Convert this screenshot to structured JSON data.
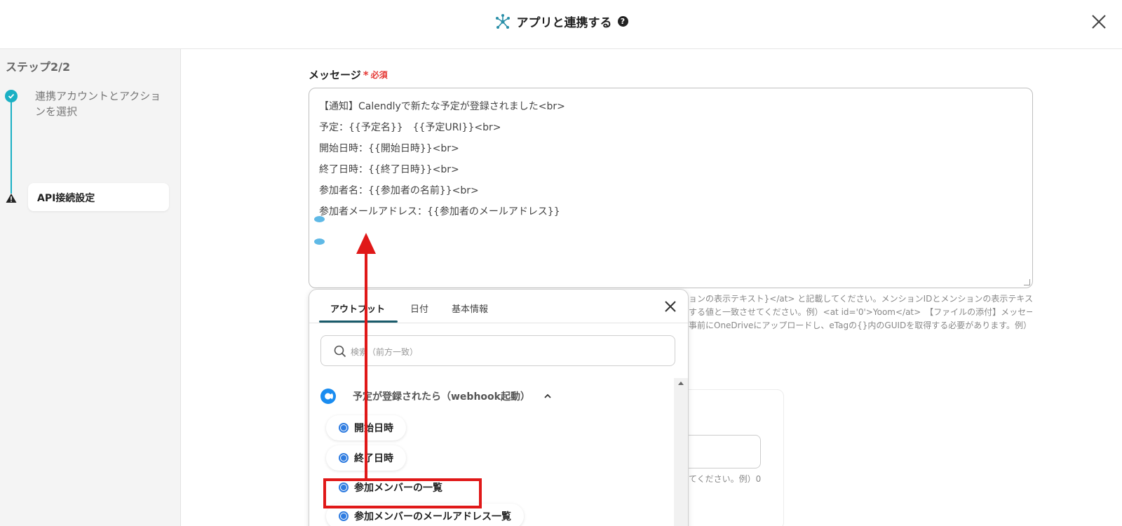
{
  "header": {
    "title": "アプリと連携する",
    "help_glyph": "?"
  },
  "sidebar": {
    "step_title": "ステップ2/2",
    "steps": [
      {
        "label": "連携アカウントとアクションを選択",
        "status": "done"
      },
      {
        "label": "API接続設定",
        "status": "warning"
      }
    ]
  },
  "message_field": {
    "label": "メッセージ",
    "required_star": "*",
    "required_text": "必須",
    "lines": [
      "【通知】Calendlyで新たな予定が登録されました<br>",
      "予定：{{予定名}}　{{予定URI}}<br>",
      "開始日時：{{開始日時}}<br>",
      "終了日時：{{終了日時}}<br>",
      "参加者名：{{参加者の名前}}<br>",
      "参加者メールアドレス：{{参加者のメールアドレス}}"
    ]
  },
  "help_lines": [
    "ョンの表示テキスト}</at> と記載してください。メンションIDとメンションの表示テキス",
    "する値と一致させてください。例）<at id='0'>Yoom</at>　【ファイルの添付】メッセー",
    "事前にOneDriveにアップロードし、eTagの{}内のGUIDを取得する必要があります。例）"
  ],
  "background_hint": "てください。例）0",
  "popup": {
    "tabs": [
      {
        "label": "アウトプット",
        "active": true
      },
      {
        "label": "日付",
        "active": false
      },
      {
        "label": "基本情報",
        "active": false
      }
    ],
    "search_placeholder": "検索（前方一致）",
    "group_label": "予定が登録されたら（webhook起動）",
    "items": [
      {
        "label": "開始日時"
      },
      {
        "label": "終了日時"
      },
      {
        "label": "参加メンバーの一覧",
        "highlighted": true
      },
      {
        "label": "参加メンバーのメールアドレス一覧"
      }
    ]
  },
  "colors": {
    "accent": "#1ab0c4",
    "required": "#e53935",
    "annotation": "#e01818",
    "radio": "#2f7ce0",
    "tab_underline": "#1a5b6b"
  },
  "icons": [
    "network-icon",
    "help-icon",
    "close-icon",
    "check-icon",
    "warning-icon",
    "search-icon",
    "calendly-icon",
    "chevron-up-icon"
  ]
}
